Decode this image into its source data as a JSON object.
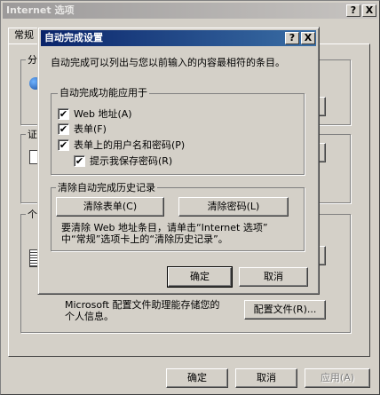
{
  "outer": {
    "title": "Internet 选项",
    "help_label": "?",
    "close_label": "X",
    "tabs": [
      {
        "label": "常规"
      }
    ],
    "partial_labels": {
      "group1": "分",
      "group2": "证",
      "group3": "个"
    },
    "profile_text": "Microsoft 配置文件助理能存储您的个人信息。",
    "profile_text_line1": "Microsoft 配置文件助理能存储您的",
    "profile_text_line2": "个人信息。",
    "profile_button": "配置文件(R)...",
    "ok": "确定",
    "cancel": "取消",
    "apply": "应用(A)"
  },
  "dialog": {
    "title": "自动完成设置",
    "help_label": "?",
    "close_label": "X",
    "intro": "自动完成可以列出与您以前输入的内容最相符的条目。",
    "group_apply": "自动完成功能应用于",
    "checks": [
      {
        "label": "Web 地址(A)",
        "checked": true
      },
      {
        "label": "表单(F)",
        "checked": true
      },
      {
        "label": "表单上的用户名和密码(P)",
        "checked": true
      },
      {
        "label": "提示我保存密码(R)",
        "checked": true
      }
    ],
    "check_mark": "✔",
    "group_clear": "清除自动完成历史记录",
    "clear_forms": "清除表单(C)",
    "clear_passwords": "清除密码(L)",
    "note_line1": "要清除 Web 地址条目，请单击“Internet 选项”",
    "note_line2": "中“常规”选项卡上的“清除历史记录”。",
    "ok": "确定",
    "cancel": "取消"
  }
}
